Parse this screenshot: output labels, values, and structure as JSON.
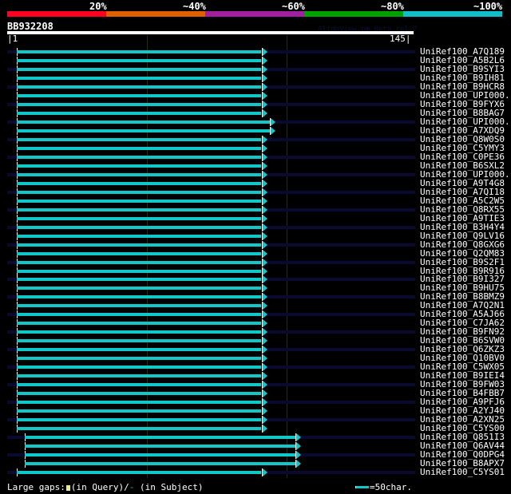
{
  "header": {
    "percent_labels": [
      "20%",
      "~40%",
      "~60%",
      "~80%",
      "~100%"
    ],
    "percent_colors": [
      "#ff0022",
      "#e06000",
      "#a020a0",
      "#00a000",
      "#10c0c8"
    ],
    "query_name": "BB932208",
    "watermark": "AlignView.pm Beta rel.7",
    "scale_start": "|1",
    "scale_end": "145|",
    "query_length": 145
  },
  "hits": [
    {
      "name": "UniRef100_A7Q189",
      "start": 4,
      "end": 91
    },
    {
      "name": "UniRef100_A5B2L6",
      "start": 4,
      "end": 91
    },
    {
      "name": "UniRef100_B9SYI3",
      "start": 4,
      "end": 91
    },
    {
      "name": "UniRef100_B9IH81",
      "start": 4,
      "end": 91
    },
    {
      "name": "UniRef100_B9HCR8",
      "start": 4,
      "end": 91
    },
    {
      "name": "UniRef100_UPI000..",
      "start": 4,
      "end": 91
    },
    {
      "name": "UniRef100_B9FYX6",
      "start": 4,
      "end": 91
    },
    {
      "name": "UniRef100_B8BAG7",
      "start": 4,
      "end": 91
    },
    {
      "name": "UniRef100_UPI000..",
      "start": 4,
      "end": 94
    },
    {
      "name": "UniRef100_A7XDQ9",
      "start": 4,
      "end": 94
    },
    {
      "name": "UniRef100_Q8W0S0",
      "start": 4,
      "end": 91
    },
    {
      "name": "UniRef100_C5YMY3",
      "start": 4,
      "end": 91
    },
    {
      "name": "UniRef100_C0PE36",
      "start": 4,
      "end": 91
    },
    {
      "name": "UniRef100_B6SXL2",
      "start": 4,
      "end": 91
    },
    {
      "name": "UniRef100_UPI000..",
      "start": 4,
      "end": 91
    },
    {
      "name": "UniRef100_A9T4G8",
      "start": 4,
      "end": 91
    },
    {
      "name": "UniRef100_A7QI18",
      "start": 4,
      "end": 91
    },
    {
      "name": "UniRef100_A5C2W5",
      "start": 4,
      "end": 91
    },
    {
      "name": "UniRef100_Q8RX55",
      "start": 4,
      "end": 91
    },
    {
      "name": "UniRef100_A9TIE3",
      "start": 4,
      "end": 91
    },
    {
      "name": "UniRef100_B3H4Y4",
      "start": 4,
      "end": 91
    },
    {
      "name": "UniRef100_Q9LV16",
      "start": 4,
      "end": 91
    },
    {
      "name": "UniRef100_Q8GXG6",
      "start": 4,
      "end": 91
    },
    {
      "name": "UniRef100_Q2QM83",
      "start": 4,
      "end": 91
    },
    {
      "name": "UniRef100_B9S2F1",
      "start": 4,
      "end": 91
    },
    {
      "name": "UniRef100_B9R916",
      "start": 4,
      "end": 91
    },
    {
      "name": "UniRef100_B9I327",
      "start": 4,
      "end": 91
    },
    {
      "name": "UniRef100_B9HU75",
      "start": 4,
      "end": 91
    },
    {
      "name": "UniRef100_B8BMZ9",
      "start": 4,
      "end": 91
    },
    {
      "name": "UniRef100_A7Q2N1",
      "start": 4,
      "end": 91
    },
    {
      "name": "UniRef100_A5AJ66",
      "start": 4,
      "end": 91
    },
    {
      "name": "UniRef100_C7JA62",
      "start": 4,
      "end": 91
    },
    {
      "name": "UniRef100_B9FN92",
      "start": 4,
      "end": 91
    },
    {
      "name": "UniRef100_B6SVW0",
      "start": 4,
      "end": 91
    },
    {
      "name": "UniRef100_Q6ZKZ3",
      "start": 4,
      "end": 91
    },
    {
      "name": "UniRef100_Q10BV0",
      "start": 4,
      "end": 91
    },
    {
      "name": "UniRef100_C5WX05",
      "start": 4,
      "end": 91
    },
    {
      "name": "UniRef100_B9IEI4",
      "start": 4,
      "end": 91
    },
    {
      "name": "UniRef100_B9FW03",
      "start": 4,
      "end": 91
    },
    {
      "name": "UniRef100_B4FBB7",
      "start": 4,
      "end": 91
    },
    {
      "name": "UniRef100_A9PFJ6",
      "start": 4,
      "end": 91
    },
    {
      "name": "UniRef100_A2YJ40",
      "start": 4,
      "end": 91
    },
    {
      "name": "UniRef100_A2XN25",
      "start": 4,
      "end": 91
    },
    {
      "name": "UniRef100_C5YS00",
      "start": 4,
      "end": 91
    },
    {
      "name": "UniRef100_Q851I3",
      "start": 7,
      "end": 103
    },
    {
      "name": "UniRef100_Q6AV44",
      "start": 7,
      "end": 103
    },
    {
      "name": "UniRef100_Q0DPG4",
      "start": 7,
      "end": 103
    },
    {
      "name": "UniRef100_B8APX7",
      "start": 7,
      "end": 103
    },
    {
      "name": "UniRef100_C5YS01",
      "start": 4,
      "end": 91
    }
  ],
  "footer": {
    "gaps_label": "Large gaps:",
    "in_query": "(in Query)/",
    "subject_mark": "-",
    "in_subject": " (in Subject)",
    "legend_text": "=50char."
  }
}
